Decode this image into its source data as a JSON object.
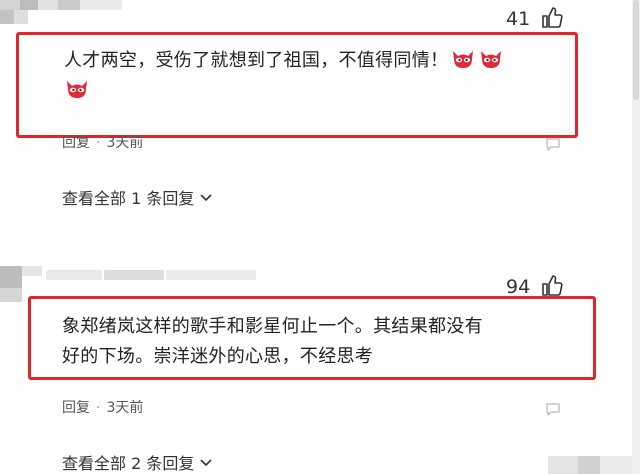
{
  "comments": [
    {
      "likes": "41",
      "text_line1": "人才两空，受伤了就想到了祖国，不值得同情！",
      "meta_reply": "回复",
      "meta_time": "3天前",
      "view_replies": "查看全部 1 条回复"
    },
    {
      "likes": "94",
      "text_line1": "象郑绪岚这样的歌手和影星何止一个。其结果都没有",
      "text_line2": "好的下场。崇洋迷外的心思，不经思考",
      "meta_reply": "回复",
      "meta_time": "3天前",
      "view_replies": "查看全部 2 条回复"
    }
  ],
  "icons": {
    "like": "thumbs-up-icon",
    "emoji": "devil-face-emoji",
    "reply": "comment-icon",
    "expand": "chevron-down-icon"
  },
  "colors": {
    "highlight_box": "#e0262b",
    "emoji_red": "#e02a3a"
  }
}
